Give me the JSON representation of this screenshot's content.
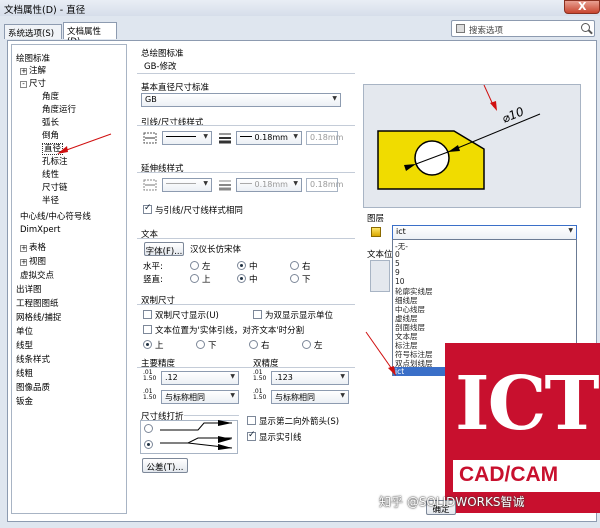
{
  "window": {
    "title": "文档属性(D) - 直径",
    "close_label": "X"
  },
  "tabs": [
    {
      "label": "系统选项(S)"
    },
    {
      "label": "文档属性(D)"
    }
  ],
  "search": {
    "placeholder": "搜索选项"
  },
  "tree": {
    "items": [
      {
        "label": "绘图标准",
        "level": 0,
        "expander": ""
      },
      {
        "label": "注解",
        "level": 1,
        "expander": "+"
      },
      {
        "label": "尺寸",
        "level": 1,
        "expander": "-"
      },
      {
        "label": "角度",
        "level": 2,
        "expander": ""
      },
      {
        "label": "角度运行",
        "level": 2,
        "expander": ""
      },
      {
        "label": "弧长",
        "level": 2,
        "expander": ""
      },
      {
        "label": "倒角",
        "level": 2,
        "expander": ""
      },
      {
        "label": "直径",
        "level": 2,
        "expander": ""
      },
      {
        "label": "孔标注",
        "level": 2,
        "expander": ""
      },
      {
        "label": "线性",
        "level": 2,
        "expander": ""
      },
      {
        "label": "尺寸链",
        "level": 2,
        "expander": ""
      },
      {
        "label": "半径",
        "level": 2,
        "expander": ""
      },
      {
        "label": "中心线/中心符号线",
        "level": 1,
        "expander": ""
      },
      {
        "label": "DimXpert",
        "level": 1,
        "expander": ""
      },
      {
        "label": "表格",
        "level": 1,
        "expander": "+"
      },
      {
        "label": "视图",
        "level": 1,
        "expander": "+"
      },
      {
        "label": "虚拟交点",
        "level": 1,
        "expander": ""
      },
      {
        "label": "出详图",
        "level": 0,
        "expander": ""
      },
      {
        "label": "工程图图纸",
        "level": 0,
        "expander": ""
      },
      {
        "label": "网格线/捕捉",
        "level": 0,
        "expander": ""
      },
      {
        "label": "单位",
        "level": 0,
        "expander": ""
      },
      {
        "label": "线型",
        "level": 0,
        "expander": ""
      },
      {
        "label": "线条样式",
        "level": 0,
        "expander": ""
      },
      {
        "label": "线粗",
        "level": 0,
        "expander": ""
      },
      {
        "label": "图像品质",
        "level": 0,
        "expander": ""
      },
      {
        "label": "钣金",
        "level": 0,
        "expander": ""
      }
    ]
  },
  "overall_standard": {
    "label": "总绘图标准",
    "value": "GB-修改"
  },
  "base_standard": {
    "label": "基本直径尺寸标准",
    "value": "GB"
  },
  "leader_style": {
    "label": "引线/尺寸线样式",
    "width": "0.18mm",
    "field": "0.18mm"
  },
  "extension_style": {
    "label": "延伸线样式",
    "width": "0.18mm",
    "field": "0.18mm",
    "same_label": "与引线/尺寸线样式相同"
  },
  "text": {
    "label": "文本",
    "font_button": "字体(F)...",
    "font_name": "汉仪长仿宋体",
    "horizontal_label": "水平:",
    "vertical_label": "竖直:",
    "h_options": [
      "左",
      "中",
      "右"
    ],
    "v_options": [
      "上",
      "中",
      "下"
    ]
  },
  "dual": {
    "label": "双制尺寸",
    "show_label": "双制尺寸显示(U)",
    "unit_label": "为双显示显示单位",
    "split_label": "文本位置为'实体引线，对齐文本'时分割",
    "positions": [
      "上",
      "下",
      "右",
      "左"
    ]
  },
  "primary_precision": {
    "label": "主要精度",
    "value1": ".12",
    "value2": "与标称相同"
  },
  "dual_precision": {
    "label": "双精度",
    "value1": ".123",
    "value2": "与标称相同"
  },
  "break": {
    "label": "尺寸线打折",
    "second_arrow": "显示第二向外箭头(S)",
    "show_leader": "显示实引线"
  },
  "tolerance_button": "公差(T)...",
  "preview": {
    "dim_text": "⌀10"
  },
  "layer": {
    "label": "图层",
    "value": "ict",
    "text_label": "文本位",
    "options": [
      "-无-",
      "0",
      "5",
      "9",
      "10",
      "轮廓实线层",
      "细线层",
      "中心线层",
      "虚线层",
      "剖面线层",
      "文本层",
      "标注层",
      "符号标注层",
      "双点划线层",
      "ict"
    ]
  },
  "watermark": {
    "big": "ICT",
    "sub": "CAD/CAM"
  },
  "zhihu": "知乎 @SOLIDWORKS智诚",
  "ok_button": "确定",
  "colors": {
    "yellow": "#f0dc00",
    "selection": "#3a6fc8",
    "brand_red": "#c8102e"
  }
}
